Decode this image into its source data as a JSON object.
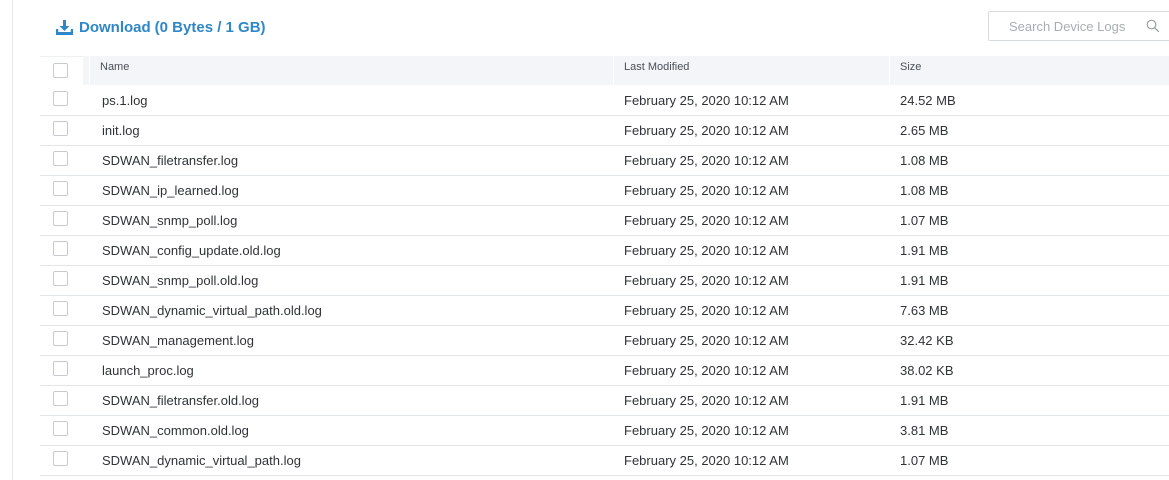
{
  "toolbar": {
    "download_label": "Download",
    "download_info": "(0 Bytes / 1 GB)",
    "download_icon": "download-icon",
    "accent_color": "#2f87c8"
  },
  "search": {
    "placeholder": "Search Device Logs",
    "value": "",
    "icon": "search-icon"
  },
  "table": {
    "columns": [
      "Name",
      "Last Modified",
      "Size"
    ],
    "rows": [
      {
        "name": "ps.1.log",
        "modified": "February 25, 2020 10:12 AM",
        "size": "24.52 MB"
      },
      {
        "name": "init.log",
        "modified": "February 25, 2020 10:12 AM",
        "size": "2.65 MB"
      },
      {
        "name": "SDWAN_filetransfer.log",
        "modified": "February 25, 2020 10:12 AM",
        "size": "1.08 MB"
      },
      {
        "name": "SDWAN_ip_learned.log",
        "modified": "February 25, 2020 10:12 AM",
        "size": "1.08 MB"
      },
      {
        "name": "SDWAN_snmp_poll.log",
        "modified": "February 25, 2020 10:12 AM",
        "size": "1.07 MB"
      },
      {
        "name": "SDWAN_config_update.old.log",
        "modified": "February 25, 2020 10:12 AM",
        "size": "1.91 MB"
      },
      {
        "name": "SDWAN_snmp_poll.old.log",
        "modified": "February 25, 2020 10:12 AM",
        "size": "1.91 MB"
      },
      {
        "name": "SDWAN_dynamic_virtual_path.old.log",
        "modified": "February 25, 2020 10:12 AM",
        "size": "7.63 MB"
      },
      {
        "name": "SDWAN_management.log",
        "modified": "February 25, 2020 10:12 AM",
        "size": "32.42 KB"
      },
      {
        "name": "launch_proc.log",
        "modified": "February 25, 2020 10:12 AM",
        "size": "38.02 KB"
      },
      {
        "name": "SDWAN_filetransfer.old.log",
        "modified": "February 25, 2020 10:12 AM",
        "size": "1.91 MB"
      },
      {
        "name": "SDWAN_common.old.log",
        "modified": "February 25, 2020 10:12 AM",
        "size": "3.81 MB"
      },
      {
        "name": "SDWAN_dynamic_virtual_path.log",
        "modified": "February 25, 2020 10:12 AM",
        "size": "1.07 MB"
      }
    ]
  }
}
